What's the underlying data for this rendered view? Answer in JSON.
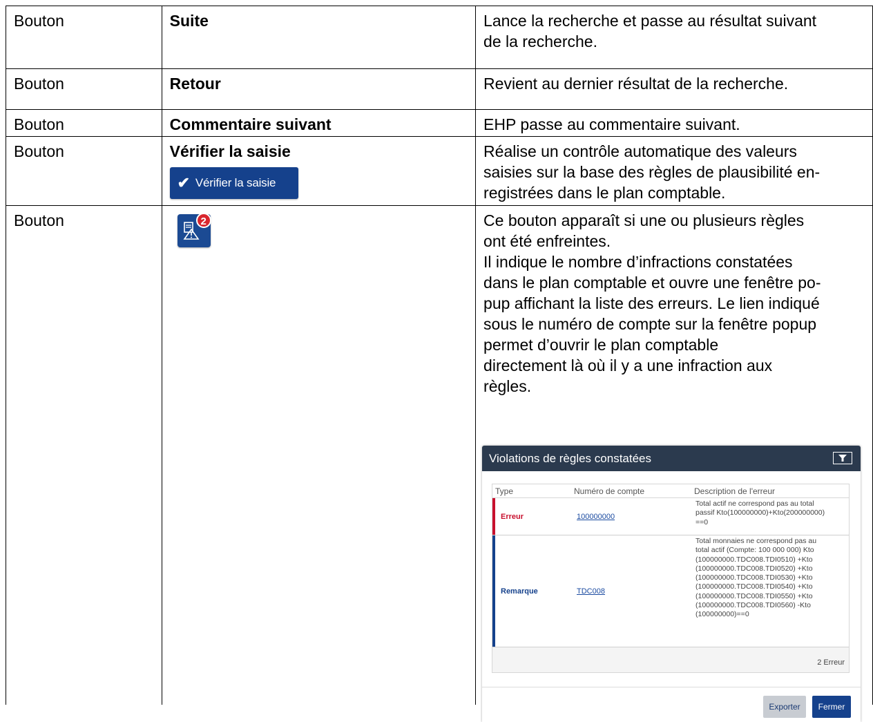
{
  "rows": [
    {
      "type": "Bouton",
      "name": "Suite",
      "desc": [
        "Lance la recherche et passe au résultat suivant",
        "de la recherche."
      ]
    },
    {
      "type": "Bouton",
      "name": "Retour",
      "desc": [
        "Revient au dernier résultat de la recherche."
      ]
    },
    {
      "type": "Bouton",
      "name": "Commentaire suivant",
      "desc": [
        "EHP passe au commentaire suivant."
      ]
    },
    {
      "type": "Bouton",
      "name": "Vérifier la saisie",
      "button_label": "Vérifier la saisie",
      "desc": [
        "Réalise un contrôle automatique des valeurs",
        "saisies sur la base des règles de plausibilité en-",
        "registrées dans le plan comptable."
      ]
    },
    {
      "type": "Bouton",
      "badge_count": "2",
      "desc": [
        "Ce bouton apparaît si une ou plusieurs règles",
        "ont été enfreintes.",
        "Il indique le nombre d’infractions constatées",
        "dans le plan comptable et ouvre une fenêtre po-",
        "pup affichant la liste des erreurs. Le lien indiqué",
        "sous le numéro de compte sur la fenêtre popup",
        "permet d’ouvrir le plan comptable",
        "directement là où il y a une infraction aux",
        "règles."
      ]
    }
  ],
  "popup": {
    "title": "Violations de règles constatées",
    "columns": [
      "Type",
      "Numéro de compte",
      "Description de l'erreur"
    ],
    "entries": [
      {
        "type": "Erreur",
        "type_color": "#c8102e",
        "account": "100000000",
        "description": [
          "Total actif ne correspond pas au total",
          "passif Kto(100000000)+Kto(200000000)",
          "==0"
        ]
      },
      {
        "type": "Remarque",
        "type_color": "#15418c",
        "account": "TDC008",
        "description": [
          "Total monnaies ne correspond pas au",
          "total actif (Compte: 100 000 000) Kto",
          "(100000000.TDC008.TDI0510) +Kto",
          "(100000000.TDC008.TDI0520) +Kto",
          "(100000000.TDC008.TDI0530) +Kto",
          "(100000000.TDC008.TDI0540) +Kto",
          "(100000000.TDC008.TDI0550) +Kto",
          "(100000000.TDC008.TDI0560) -Kto",
          "(100000000)==0"
        ]
      }
    ],
    "footer_count": "2 Erreur",
    "export_label": "Exporter",
    "close_label": "Fermer"
  },
  "colors": {
    "button_blue": "#15418c",
    "header_dark": "#2b3a4e",
    "badge_red": "#d9262e"
  }
}
